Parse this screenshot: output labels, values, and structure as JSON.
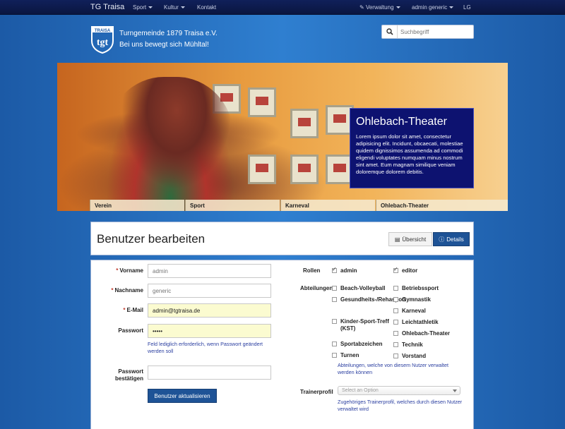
{
  "navbar": {
    "brand": "TG Traisa",
    "items": [
      "Sport",
      "Kultur",
      "Kontakt"
    ],
    "right_items": [
      "Verwaltung",
      "admin generic",
      "LG"
    ]
  },
  "header": {
    "logo_text": "TRAISA",
    "logo_mark": "tgt",
    "title": "Turngemeinde 1879 Traisa e.V.",
    "slogan": "Bei uns bewegt sich Mühltal!",
    "search_placeholder": "Suchbegriff"
  },
  "banner": {
    "caption_title": "Ohlebach-Theater",
    "caption_text": "Lorem ipsum dolor sit amet, consectetur adipisicing elit. Incidunt, obcaecati, molestiae quidem dignissimos assumenda ad commodi eligendi voluptates numquam minus nostrum sint amet. Eum magnam similique veniam doloremque dolorem debitis.",
    "tabs": [
      "Verein",
      "Sport",
      "Karneval",
      "Ohlebach-Theater"
    ]
  },
  "page": {
    "title": "Benutzer bearbeiten",
    "btn_overview": "Übersicht",
    "btn_details": "Details"
  },
  "form": {
    "vorname_label": "Vorname",
    "vorname_placeholder": "admin",
    "nachname_label": "Nachname",
    "nachname_placeholder": "generic",
    "email_label": "E-Mail",
    "email_value": "admin@tgtraisa.de",
    "passwort_label": "Passwort",
    "passwort_value": "•••••",
    "passwort_help": "Feld lediglich erforderlich, wenn Passwort geändert werden soll",
    "passwort2_label": "Passwort bestätigen",
    "submit_label": "Benutzer aktualisieren",
    "rollen_label": "Rollen",
    "rollen": [
      {
        "label": "admin",
        "checked": true
      },
      {
        "label": "editor",
        "checked": true
      }
    ],
    "abteilungen_label": "Abteilungen",
    "abteilungen_left": [
      "Beach-Volleyball",
      "Gesundheits-/Rehasport",
      "Kinder-Sport-Treff (KST)",
      "Sportabzeichen",
      "Turnen"
    ],
    "abteilungen_right": [
      "Betriebssport",
      "Gymnastik",
      "Karneval",
      "Leichtathletik",
      "Ohlebach-Theater",
      "Technik",
      "Vorstand"
    ],
    "abteilungen_help": "Abteilungen, welche von diesem Nutzer verwaltet werden können",
    "trainerprofil_label": "Trainerprofil",
    "trainerprofil_placeholder": "Select an Option",
    "trainerprofil_help": "Zugehöriges Trainerprofil, welches durch diesen Nutzer verwaltet wird"
  },
  "colors": {
    "navbar": "#0a1640",
    "primary_button": "#1e5396",
    "caption_bg": "#0d1270",
    "help_text": "#2a3ea0"
  }
}
